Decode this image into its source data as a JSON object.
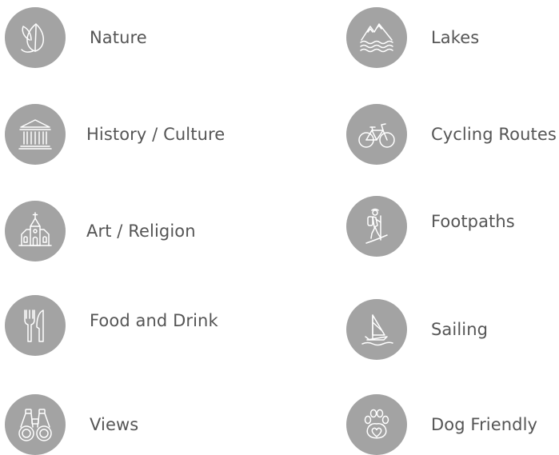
{
  "categories": {
    "nature": {
      "label": "Nature",
      "icon": "leaf-icon"
    },
    "history": {
      "label": "History / Culture",
      "icon": "temple-icon"
    },
    "art": {
      "label": "Art / Religion",
      "icon": "church-icon"
    },
    "food": {
      "label": "Food and Drink",
      "icon": "fork-knife-icon"
    },
    "views": {
      "label": "Views",
      "icon": "binoculars-icon"
    },
    "lakes": {
      "label": "Lakes",
      "icon": "mountain-lake-icon"
    },
    "cycling": {
      "label": "Cycling Routes",
      "icon": "bicycle-icon"
    },
    "foot": {
      "label": "Footpaths",
      "icon": "hiker-icon"
    },
    "sailing": {
      "label": "Sailing",
      "icon": "sailboat-icon"
    },
    "dog": {
      "label": "Dog Friendly",
      "icon": "paw-heart-icon"
    }
  },
  "colors": {
    "icon_background": "#a3a3a3",
    "icon_stroke": "#ffffff",
    "label_text": "#555555"
  }
}
